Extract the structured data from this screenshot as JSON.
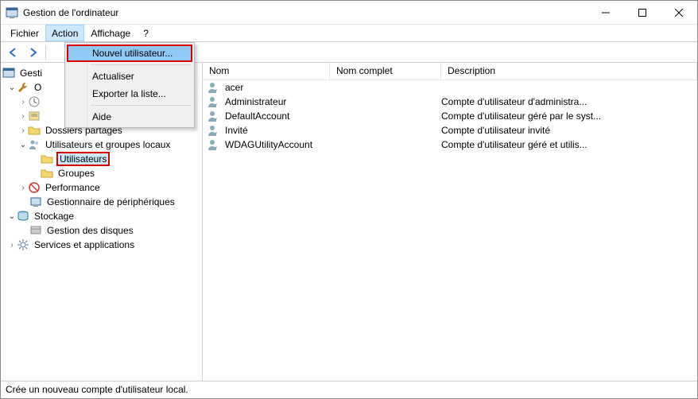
{
  "window": {
    "title": "Gestion de l'ordinateur"
  },
  "menu": {
    "file": "Fichier",
    "action": "Action",
    "view": "Affichage",
    "help": "?"
  },
  "dropdown": {
    "new_user": "Nouvel utilisateur...",
    "refresh": "Actualiser",
    "export": "Exporter la liste...",
    "help": "Aide"
  },
  "tree": {
    "root": "Gesti",
    "system_tools": "O",
    "scheduler_hidden": "",
    "eventvwr_hidden": "",
    "shared_folders": "Dossiers partagés",
    "local_users": "Utilisateurs et groupes locaux",
    "users": "Utilisateurs",
    "groups": "Groupes",
    "performance": "Performance",
    "devmgr": "Gestionnaire de périphériques",
    "storage": "Stockage",
    "diskmgmt": "Gestion des disques",
    "services": "Services et applications"
  },
  "columns": {
    "name": "Nom",
    "fullname": "Nom complet",
    "desc": "Description"
  },
  "users": [
    {
      "name": "acer",
      "fullname": "",
      "desc": ""
    },
    {
      "name": "Administrateur",
      "fullname": "",
      "desc": "Compte d'utilisateur d'administra..."
    },
    {
      "name": "DefaultAccount",
      "fullname": "",
      "desc": "Compte d'utilisateur géré par le syst..."
    },
    {
      "name": "Invité",
      "fullname": "",
      "desc": "Compte d'utilisateur invité"
    },
    {
      "name": "WDAGUtilityAccount",
      "fullname": "",
      "desc": "Compte d'utilisateur géré et utilis..."
    }
  ],
  "status": "Crée un nouveau compte d'utilisateur local."
}
